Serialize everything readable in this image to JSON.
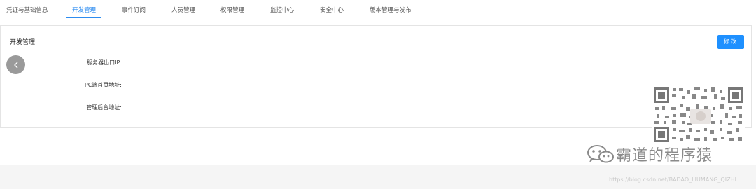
{
  "tabs": [
    {
      "label": "凭证与基础信息"
    },
    {
      "label": "开发管理",
      "active": true
    },
    {
      "label": "事件订阅"
    },
    {
      "label": "人员管理"
    },
    {
      "label": "权限管理"
    },
    {
      "label": "监控中心"
    },
    {
      "label": "安全中心"
    },
    {
      "label": "版本管理与发布"
    }
  ],
  "panel": {
    "title": "开发管理",
    "edit_label": "修改",
    "fields": [
      {
        "label": "服务器出口IP:",
        "value": ""
      },
      {
        "label": "PC端首页地址:",
        "value": ""
      },
      {
        "label": "管理后台地址:",
        "value": ""
      }
    ]
  },
  "watermark": {
    "brand_text": "霸道的程序猿",
    "url_text": "https://blog.csdn.net/BADAO_LIUMANG_QIZHI"
  },
  "colors": {
    "accent": "#2d8cf0",
    "button": "#1e90ff",
    "back_button": "#9a9a9a",
    "footer": "#f5f5f5"
  }
}
